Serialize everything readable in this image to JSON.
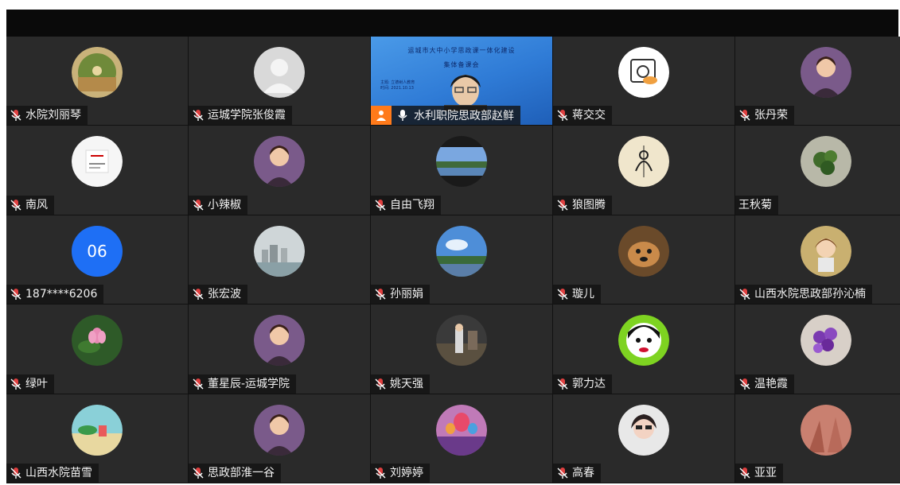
{
  "participants": [
    {
      "name": "水院刘丽琴",
      "mic": true,
      "avatar": "landscape-photo"
    },
    {
      "name": "运城学院张俊霞",
      "mic": true,
      "avatar": "default-person"
    },
    {
      "name": "水利职院思政部赵鲜",
      "mic": true,
      "presenter": true
    },
    {
      "name": "蒋交交",
      "mic": true,
      "avatar": "cartoon-drawing"
    },
    {
      "name": "张丹荣",
      "mic": true,
      "avatar": "portrait-photo"
    },
    {
      "name": "南风",
      "mic": true,
      "avatar": "card-image"
    },
    {
      "name": "小辣椒",
      "mic": true,
      "avatar": "portrait-photo"
    },
    {
      "name": "自由飞翔",
      "mic": true,
      "avatar": "river-photo"
    },
    {
      "name": "狼图腾",
      "mic": true,
      "avatar": "sketch-drawing"
    },
    {
      "name": "王秋菊",
      "mic": false,
      "avatar": "plant-photo"
    },
    {
      "name": "187****6206",
      "mic": true,
      "avatar_text": "06"
    },
    {
      "name": "张宏波",
      "mic": true,
      "avatar": "city-photo"
    },
    {
      "name": "孙丽娟",
      "mic": true,
      "avatar": "sky-photo"
    },
    {
      "name": "璇儿",
      "mic": true,
      "avatar": "dog-photo"
    },
    {
      "name": "山西水院思政部孙沁楠",
      "mic": true,
      "avatar": "cartoon-girl"
    },
    {
      "name": "绿叶",
      "mic": true,
      "avatar": "lotus-photo"
    },
    {
      "name": "董星辰-运城学院",
      "mic": true,
      "avatar": "portrait-photo"
    },
    {
      "name": "姚天强",
      "mic": true,
      "avatar": "outdoor-photo"
    },
    {
      "name": "郭力达",
      "mic": true,
      "avatar": "cartoon-face"
    },
    {
      "name": "温艳霞",
      "mic": true,
      "avatar": "flower-photo"
    },
    {
      "name": "山西水院苗雪",
      "mic": true,
      "avatar": "beach-illustration"
    },
    {
      "name": "思政部淮一谷",
      "mic": true,
      "avatar": "portrait-photo"
    },
    {
      "name": "刘婷婷",
      "mic": true,
      "avatar": "balloon-illustration"
    },
    {
      "name": "高春",
      "mic": true,
      "avatar": "portrait-sunglasses"
    },
    {
      "name": "亚亚",
      "mic": true,
      "avatar": "abstract-photo"
    }
  ],
  "presenter_slide": {
    "title_line1": "运城市大中小学思政课一体化建设",
    "title_line2": "集体备课会",
    "small_line1": "主题: 立德树人教育",
    "small_line2": "时间: 2021.10.13"
  },
  "colors": {
    "tile_bg": "#2a2a2a",
    "frame_bg": "#161616",
    "number_avatar": "#1e6ff5",
    "presenter_badge": "#ff7a1a",
    "mic_red": "#e04040"
  }
}
